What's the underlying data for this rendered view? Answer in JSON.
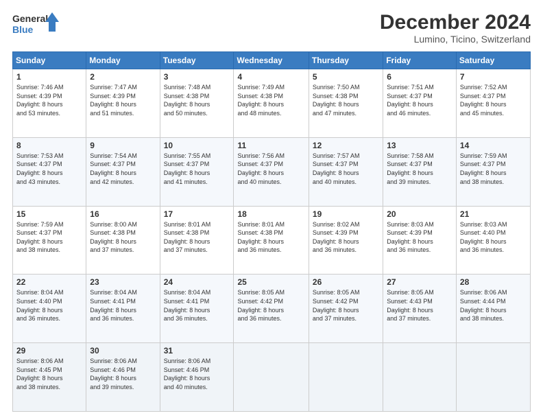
{
  "logo": {
    "line1": "General",
    "line2": "Blue"
  },
  "title": "December 2024",
  "subtitle": "Lumino, Ticino, Switzerland",
  "days_of_week": [
    "Sunday",
    "Monday",
    "Tuesday",
    "Wednesday",
    "Thursday",
    "Friday",
    "Saturday"
  ],
  "weeks": [
    [
      {
        "day": "1",
        "info": "Sunrise: 7:46 AM\nSunset: 4:39 PM\nDaylight: 8 hours\nand 53 minutes."
      },
      {
        "day": "2",
        "info": "Sunrise: 7:47 AM\nSunset: 4:39 PM\nDaylight: 8 hours\nand 51 minutes."
      },
      {
        "day": "3",
        "info": "Sunrise: 7:48 AM\nSunset: 4:38 PM\nDaylight: 8 hours\nand 50 minutes."
      },
      {
        "day": "4",
        "info": "Sunrise: 7:49 AM\nSunset: 4:38 PM\nDaylight: 8 hours\nand 48 minutes."
      },
      {
        "day": "5",
        "info": "Sunrise: 7:50 AM\nSunset: 4:38 PM\nDaylight: 8 hours\nand 47 minutes."
      },
      {
        "day": "6",
        "info": "Sunrise: 7:51 AM\nSunset: 4:37 PM\nDaylight: 8 hours\nand 46 minutes."
      },
      {
        "day": "7",
        "info": "Sunrise: 7:52 AM\nSunset: 4:37 PM\nDaylight: 8 hours\nand 45 minutes."
      }
    ],
    [
      {
        "day": "8",
        "info": "Sunrise: 7:53 AM\nSunset: 4:37 PM\nDaylight: 8 hours\nand 43 minutes."
      },
      {
        "day": "9",
        "info": "Sunrise: 7:54 AM\nSunset: 4:37 PM\nDaylight: 8 hours\nand 42 minutes."
      },
      {
        "day": "10",
        "info": "Sunrise: 7:55 AM\nSunset: 4:37 PM\nDaylight: 8 hours\nand 41 minutes."
      },
      {
        "day": "11",
        "info": "Sunrise: 7:56 AM\nSunset: 4:37 PM\nDaylight: 8 hours\nand 40 minutes."
      },
      {
        "day": "12",
        "info": "Sunrise: 7:57 AM\nSunset: 4:37 PM\nDaylight: 8 hours\nand 40 minutes."
      },
      {
        "day": "13",
        "info": "Sunrise: 7:58 AM\nSunset: 4:37 PM\nDaylight: 8 hours\nand 39 minutes."
      },
      {
        "day": "14",
        "info": "Sunrise: 7:59 AM\nSunset: 4:37 PM\nDaylight: 8 hours\nand 38 minutes."
      }
    ],
    [
      {
        "day": "15",
        "info": "Sunrise: 7:59 AM\nSunset: 4:37 PM\nDaylight: 8 hours\nand 38 minutes."
      },
      {
        "day": "16",
        "info": "Sunrise: 8:00 AM\nSunset: 4:38 PM\nDaylight: 8 hours\nand 37 minutes."
      },
      {
        "day": "17",
        "info": "Sunrise: 8:01 AM\nSunset: 4:38 PM\nDaylight: 8 hours\nand 37 minutes."
      },
      {
        "day": "18",
        "info": "Sunrise: 8:01 AM\nSunset: 4:38 PM\nDaylight: 8 hours\nand 36 minutes."
      },
      {
        "day": "19",
        "info": "Sunrise: 8:02 AM\nSunset: 4:39 PM\nDaylight: 8 hours\nand 36 minutes."
      },
      {
        "day": "20",
        "info": "Sunrise: 8:03 AM\nSunset: 4:39 PM\nDaylight: 8 hours\nand 36 minutes."
      },
      {
        "day": "21",
        "info": "Sunrise: 8:03 AM\nSunset: 4:40 PM\nDaylight: 8 hours\nand 36 minutes."
      }
    ],
    [
      {
        "day": "22",
        "info": "Sunrise: 8:04 AM\nSunset: 4:40 PM\nDaylight: 8 hours\nand 36 minutes."
      },
      {
        "day": "23",
        "info": "Sunrise: 8:04 AM\nSunset: 4:41 PM\nDaylight: 8 hours\nand 36 minutes."
      },
      {
        "day": "24",
        "info": "Sunrise: 8:04 AM\nSunset: 4:41 PM\nDaylight: 8 hours\nand 36 minutes."
      },
      {
        "day": "25",
        "info": "Sunrise: 8:05 AM\nSunset: 4:42 PM\nDaylight: 8 hours\nand 36 minutes."
      },
      {
        "day": "26",
        "info": "Sunrise: 8:05 AM\nSunset: 4:42 PM\nDaylight: 8 hours\nand 37 minutes."
      },
      {
        "day": "27",
        "info": "Sunrise: 8:05 AM\nSunset: 4:43 PM\nDaylight: 8 hours\nand 37 minutes."
      },
      {
        "day": "28",
        "info": "Sunrise: 8:06 AM\nSunset: 4:44 PM\nDaylight: 8 hours\nand 38 minutes."
      }
    ],
    [
      {
        "day": "29",
        "info": "Sunrise: 8:06 AM\nSunset: 4:45 PM\nDaylight: 8 hours\nand 38 minutes."
      },
      {
        "day": "30",
        "info": "Sunrise: 8:06 AM\nSunset: 4:46 PM\nDaylight: 8 hours\nand 39 minutes."
      },
      {
        "day": "31",
        "info": "Sunrise: 8:06 AM\nSunset: 4:46 PM\nDaylight: 8 hours\nand 40 minutes."
      },
      {
        "day": "",
        "info": ""
      },
      {
        "day": "",
        "info": ""
      },
      {
        "day": "",
        "info": ""
      },
      {
        "day": "",
        "info": ""
      }
    ]
  ]
}
